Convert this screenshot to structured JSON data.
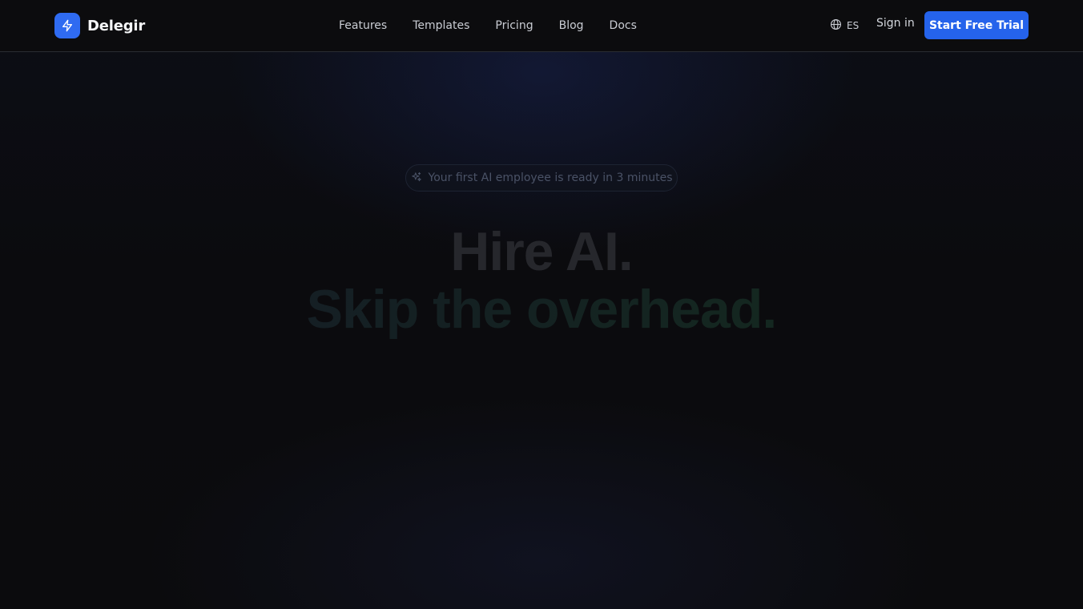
{
  "header": {
    "brand": "Delegir",
    "nav": [
      {
        "label": "Features"
      },
      {
        "label": "Templates"
      },
      {
        "label": "Pricing"
      },
      {
        "label": "Blog"
      },
      {
        "label": "Docs"
      }
    ],
    "language": {
      "code": "ES",
      "icon": "globe-icon"
    },
    "sign_in_label": "Sign in",
    "cta_label": "Start Free Trial"
  },
  "hero": {
    "badge_text": "Your first AI employee is ready in 3 minutes",
    "badge_icon": "sparkle-icon",
    "title_line1": "Hire AI.",
    "title_line2": "Skip the overhead."
  },
  "colors": {
    "accent": "#2563eb",
    "logo_bg": "#2f6bf1",
    "background": "#0b0b0d"
  }
}
